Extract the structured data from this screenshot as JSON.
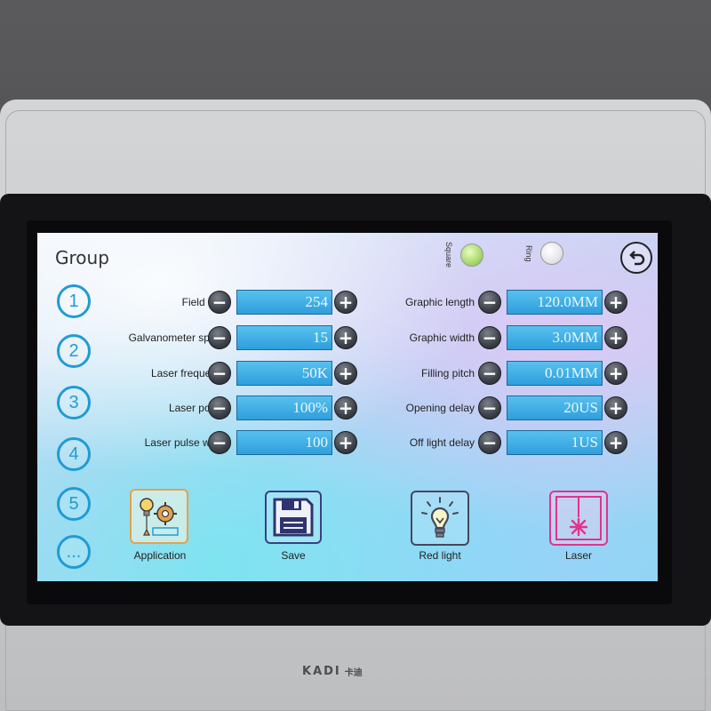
{
  "screen": {
    "title": "Group",
    "back_icon": "back-arrow-icon",
    "modes": [
      {
        "label": "Square",
        "state": "on"
      },
      {
        "label": "Ring",
        "state": "off"
      }
    ],
    "groups": [
      "1",
      "2",
      "3",
      "4",
      "5",
      "..."
    ],
    "left_params": [
      {
        "label": "Field lens",
        "value": "254"
      },
      {
        "label": "Galvanometer speed",
        "value": "15"
      },
      {
        "label": "Laser frequency",
        "value": "50K"
      },
      {
        "label": "Laser power",
        "value": "100%"
      },
      {
        "label": "Laser pulse width",
        "value": "100"
      }
    ],
    "right_params": [
      {
        "label": "Graphic length",
        "value": "120.0MM"
      },
      {
        "label": "Graphic width",
        "value": "3.0MM"
      },
      {
        "label": "Filling pitch",
        "value": "0.01MM"
      },
      {
        "label": "Opening delay",
        "value": "20US"
      },
      {
        "label": "Off light delay",
        "value": "1US"
      }
    ],
    "minus_symbol": "−",
    "plus_symbol": "+",
    "actions": [
      {
        "label": "Application",
        "icon": "application-icon",
        "color": "#e5a24a"
      },
      {
        "label": "Save",
        "icon": "floppy-disk-icon",
        "color": "#3b3f82"
      },
      {
        "label": "Red light",
        "icon": "light-bulb-icon",
        "color": "#44485a"
      },
      {
        "label": "Laser",
        "icon": "laser-icon",
        "color": "#e2338c"
      }
    ]
  },
  "device": {
    "brand": "KADI",
    "brand_cn": "卡迪"
  }
}
